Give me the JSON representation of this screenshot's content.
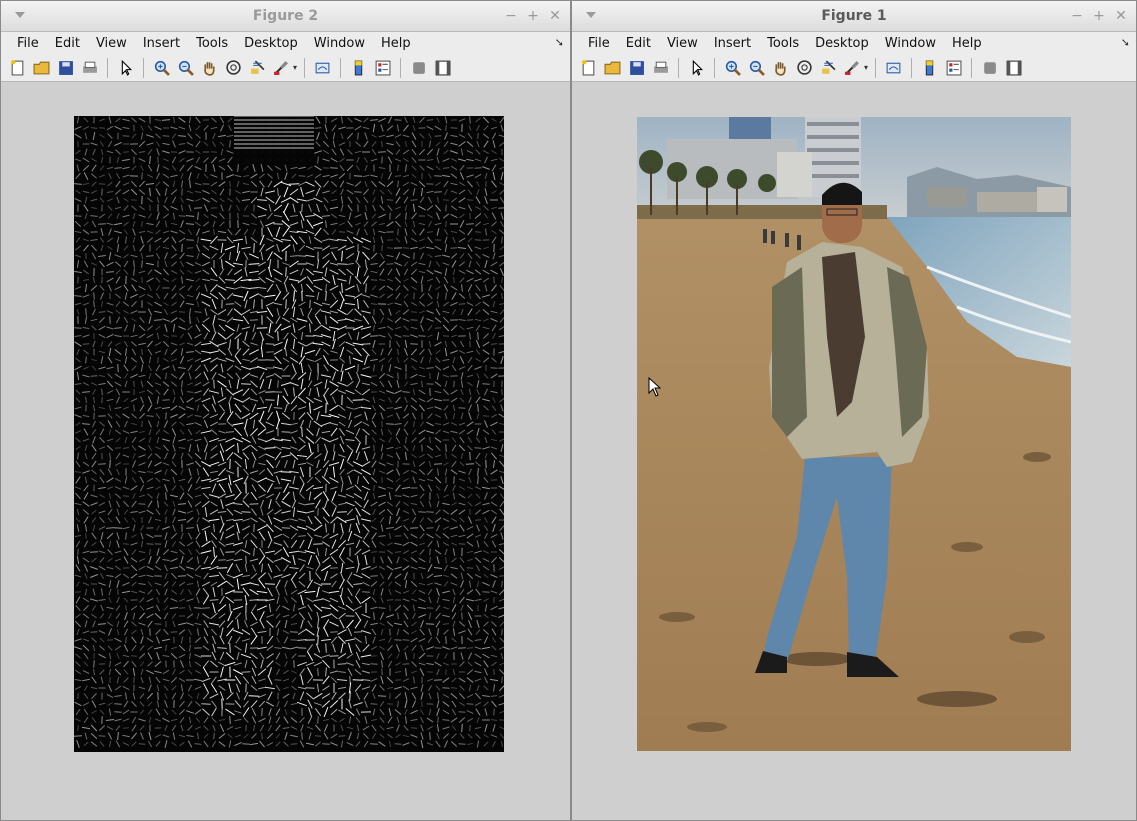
{
  "figure2": {
    "title": "Figure 2",
    "menu": [
      "File",
      "Edit",
      "View",
      "Insert",
      "Tools",
      "Desktop",
      "Window",
      "Help"
    ]
  },
  "figure1": {
    "title": "Figure 1",
    "menu": [
      "File",
      "Edit",
      "View",
      "Insert",
      "Tools",
      "Desktop",
      "Window",
      "Help"
    ]
  },
  "toolbar_icons": [
    "new-figure-icon",
    "open-file-icon",
    "save-icon",
    "print-icon",
    "edit-plot-arrow-icon",
    "zoom-in-icon",
    "zoom-out-icon",
    "pan-hand-icon",
    "rotate-3d-icon",
    "data-cursor-icon",
    "brush-icon",
    "link-plot-icon",
    "colorbar-icon",
    "legend-icon",
    "hide-plot-tools-icon",
    "show-plot-tools-icon"
  ],
  "colors": {
    "window_bg": "#cfcfcf",
    "menubar_bg": "#ececec",
    "title_inactive": "#9a9a9a",
    "title_active": "#5a5a5a"
  }
}
